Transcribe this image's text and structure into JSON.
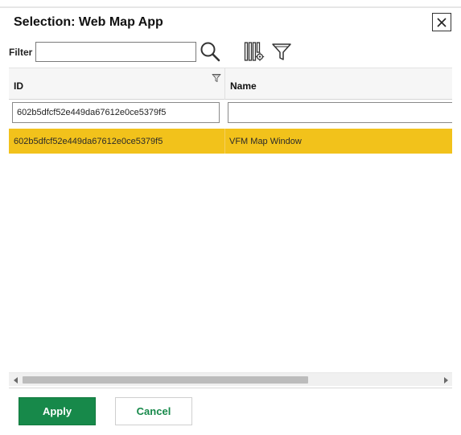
{
  "dialog": {
    "title": "Selection: Web Map App",
    "close_icon": "close-icon"
  },
  "toolbar": {
    "filter_label": "Filter",
    "filter_value": "",
    "search_icon": "search-icon",
    "columns_icon": "columns-settings-icon",
    "filter_icon": "funnel-icon"
  },
  "grid": {
    "columns": [
      {
        "label": "ID",
        "filter_value": "602b5dfcf52e449da67612e0ce5379f5"
      },
      {
        "label": "Name",
        "filter_value": ""
      }
    ],
    "rows": [
      {
        "id": "602b5dfcf52e449da67612e0ce5379f5",
        "name": "VFM Map Window",
        "selected": true
      }
    ],
    "selected_color": "#f2c21b"
  },
  "footer": {
    "apply_label": "Apply",
    "cancel_label": "Cancel",
    "accent_color": "#17894a"
  }
}
